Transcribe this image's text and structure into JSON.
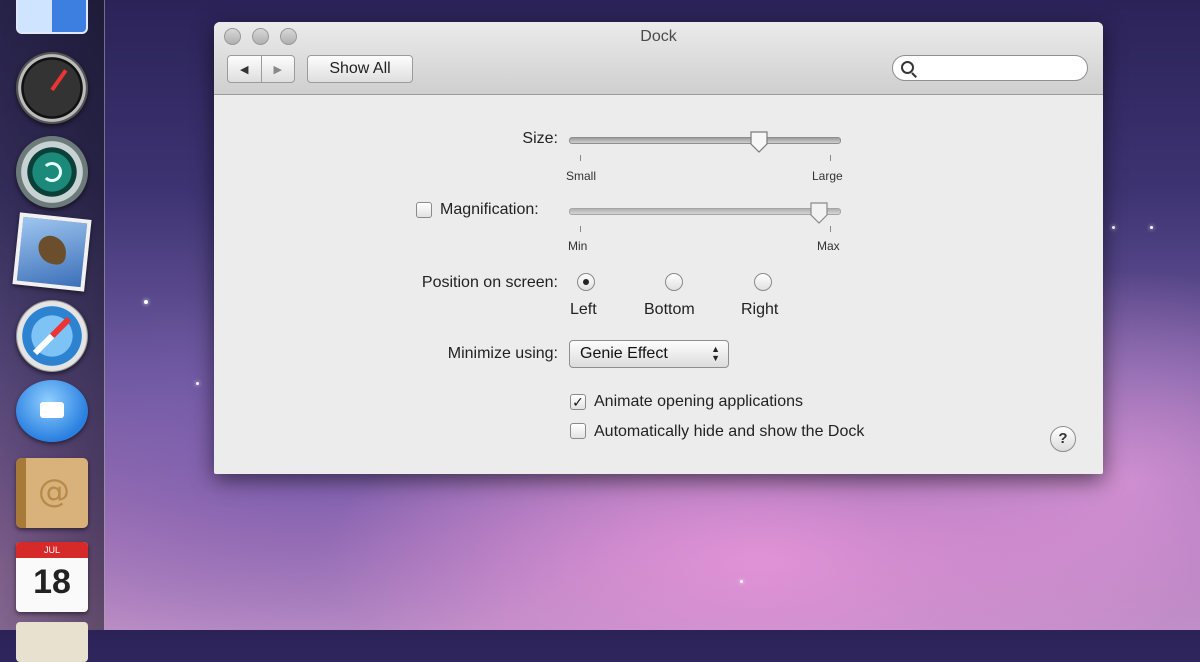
{
  "window": {
    "title": "Dock",
    "nav_back": "◀",
    "nav_forward": "▶",
    "show_all": "Show All",
    "search_placeholder": ""
  },
  "size": {
    "label": "Size:",
    "min_label": "Small",
    "max_label": "Large",
    "value": 0.72
  },
  "magnification": {
    "label": "Magnification:",
    "checked": false,
    "min_label": "Min",
    "max_label": "Max",
    "value": 0.96
  },
  "position": {
    "label": "Position on screen:",
    "options": [
      "Left",
      "Bottom",
      "Right"
    ],
    "selected": "Left"
  },
  "minimize": {
    "label": "Minimize using:",
    "value": "Genie Effect"
  },
  "options": {
    "animate": {
      "label": "Animate opening applications",
      "checked": true
    },
    "autohide": {
      "label": "Automatically hide and show the Dock",
      "checked": false
    }
  },
  "help": "?",
  "dock": {
    "icons": [
      "finder-icon",
      "dashboard-icon",
      "time-machine-icon",
      "mail-icon",
      "safari-icon",
      "ichat-icon",
      "address-book-icon",
      "ical-icon"
    ],
    "ical_day": "18",
    "ical_month": "JUL"
  }
}
